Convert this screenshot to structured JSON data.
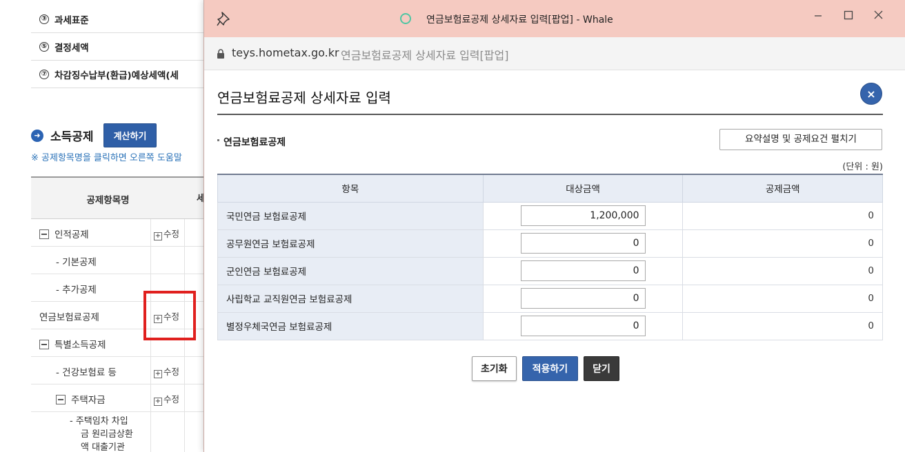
{
  "background": {
    "tax_rows": [
      {
        "num": "③",
        "label": "과세표준"
      },
      {
        "num": "⑤",
        "label": "결정세액"
      },
      {
        "num": "⑦",
        "label": "차감징수납부(환급)예상세액(세"
      }
    ],
    "section_title": "소득공제",
    "calc_button": "계산하기",
    "notice": "※ 공제항목명을 클릭하면 오른쪽 도움말",
    "table_header": {
      "col1": "공제항목명",
      "col2": "세"
    },
    "rows": [
      {
        "label": "인적공제",
        "edit": "수정",
        "kind": "minus"
      },
      {
        "label": "- 기본공제",
        "edit": "",
        "kind": "sub"
      },
      {
        "label": "- 추가공제",
        "edit": "",
        "kind": "sub"
      },
      {
        "label": "연금보험료공제",
        "edit": "수정",
        "kind": "plain"
      },
      {
        "label": "특별소득공제",
        "edit": "",
        "kind": "minus"
      },
      {
        "label": "- 건강보험료 등",
        "edit": "수정",
        "kind": "sub"
      },
      {
        "label": "주택자금",
        "edit": "수정",
        "kind": "minus-sub"
      }
    ],
    "last_row_lines": [
      "- 주택임차 차입",
      "금 원리금상환",
      "액 대출기관"
    ]
  },
  "window": {
    "title": "연금보험료공제 상세자료 입력[팝업] - Whale",
    "host": "teys.hometax.go.kr",
    "page_title": "연금보험료공제 상세자료 입력[팝업]",
    "titlebar_color": "#f5cac1"
  },
  "popup": {
    "header": "연금보험료공제 상세자료 입력",
    "close_icon": "×",
    "subtitle": "연금보험료공제",
    "summary_button": "요약설명 및 공제요건 펼치기",
    "unit": "(단위 : 원)",
    "columns": [
      "항목",
      "대상금액",
      "공제금액"
    ],
    "rows": [
      {
        "item": "국민연금 보험료공제",
        "amount": "1,200,000",
        "deduction": "0"
      },
      {
        "item": "공무원연금 보험료공제",
        "amount": "0",
        "deduction": "0"
      },
      {
        "item": "군인연금 보험료공제",
        "amount": "0",
        "deduction": "0"
      },
      {
        "item": "사립학교 교직원연금 보험료공제",
        "amount": "0",
        "deduction": "0"
      },
      {
        "item": "별정우체국연금 보험료공제",
        "amount": "0",
        "deduction": "0"
      }
    ],
    "buttons": {
      "reset": "초기화",
      "apply": "적용하기",
      "close": "닫기"
    },
    "accent_color": "#3564ac"
  }
}
